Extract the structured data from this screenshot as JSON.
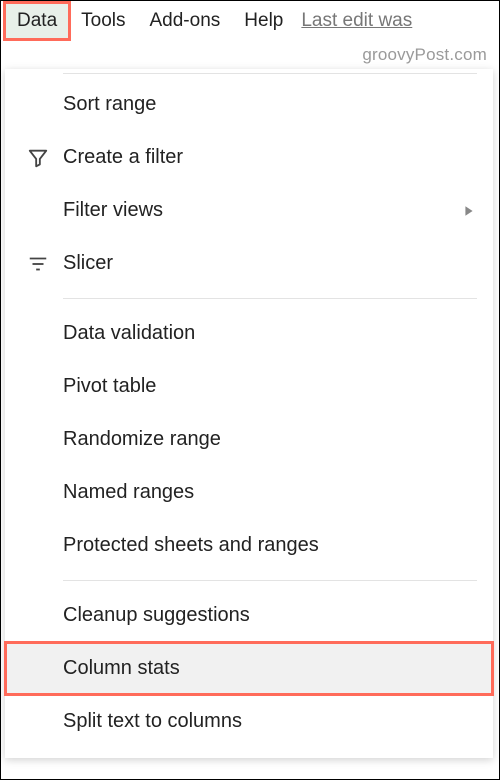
{
  "menubar": {
    "data": "Data",
    "tools": "Tools",
    "addons": "Add-ons",
    "help": "Help",
    "edit_status": "Last edit was"
  },
  "watermark": "groovyPost.com",
  "dropdown": {
    "sort_range": "Sort range",
    "create_filter": "Create a filter",
    "filter_views": "Filter views",
    "slicer": "Slicer",
    "data_validation": "Data validation",
    "pivot_table": "Pivot table",
    "randomize_range": "Randomize range",
    "named_ranges": "Named ranges",
    "protected": "Protected sheets and ranges",
    "cleanup": "Cleanup suggestions",
    "column_stats": "Column stats",
    "split_text": "Split text to columns"
  }
}
